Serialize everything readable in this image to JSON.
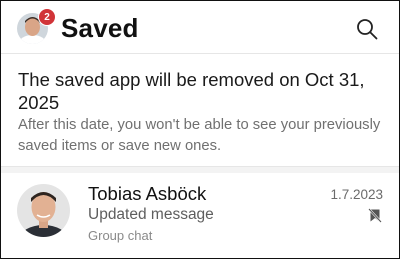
{
  "header": {
    "title": "Saved",
    "notification_count": "2"
  },
  "notice": {
    "title": "The saved app will be removed on Oct 31, 2025",
    "body": "After this date, you won't be able to see your previously saved items or save new ones."
  },
  "chats": [
    {
      "name": "Tobias Asböck",
      "date": "1.7.2023",
      "message": "Updated message",
      "type": "Group chat"
    }
  ],
  "icons": {
    "search": "search-icon",
    "unsave": "bookmark-remove-icon"
  },
  "colors": {
    "badge": "#d13438",
    "secondary_text": "#707070"
  }
}
